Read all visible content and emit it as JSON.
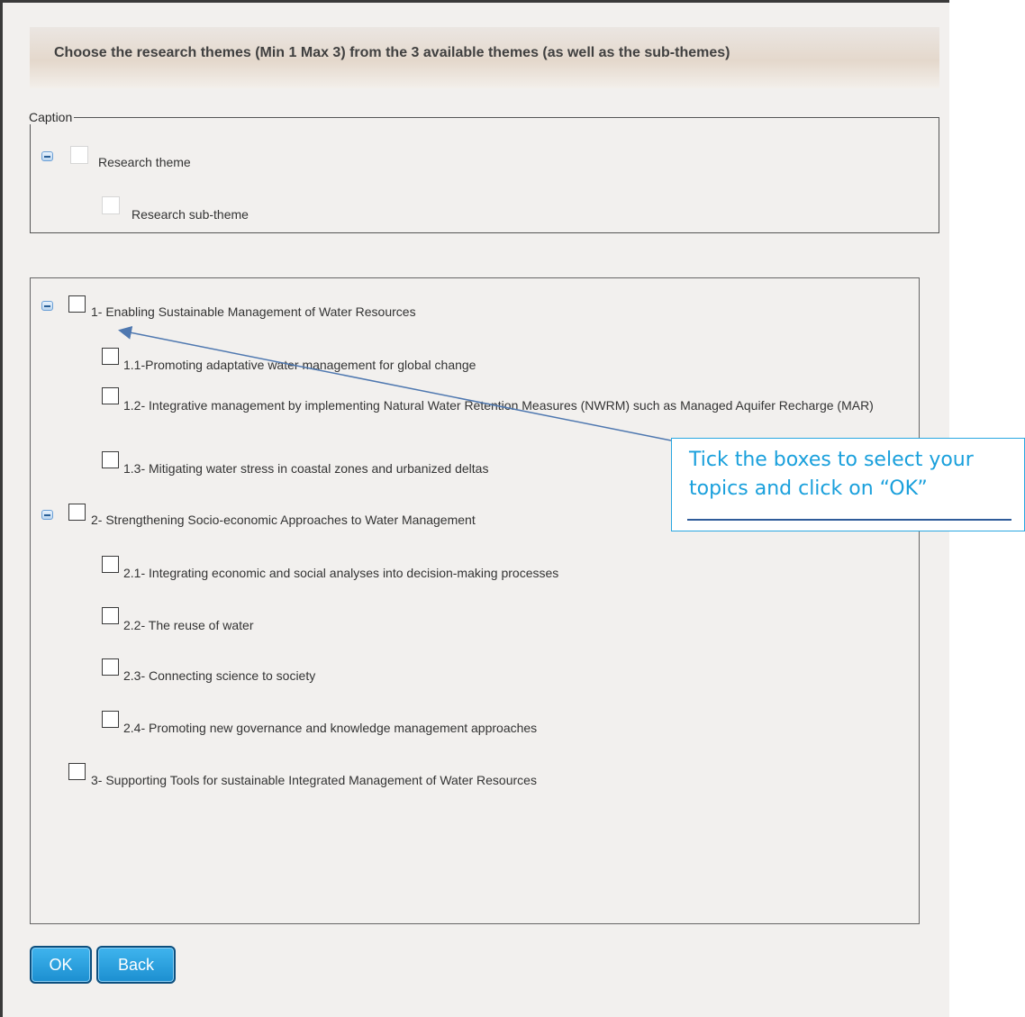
{
  "header": {
    "title": "Choose the research themes (Min 1 Max 3) from the 3 available themes (as well as the sub-themes)"
  },
  "caption": {
    "legend": "Caption",
    "theme_label": "Research theme",
    "subtheme_label": "Research sub-theme"
  },
  "themes": [
    {
      "label": "1- Enabling Sustainable Management of Water Resources",
      "subthemes": [
        "1.1-Promoting adaptative water management for global change",
        "1.2- Integrative management by implementing Natural Water Retention Measures (NWRM) such as Managed Aquifer Recharge (MAR)",
        "1.3- Mitigating water stress in coastal zones and urbanized deltas"
      ]
    },
    {
      "label": "2- Strengthening Socio-economic Approaches to Water Management",
      "subthemes": [
        "2.1- Integrating economic and social analyses into decision-making processes",
        "2.2- The reuse of water",
        "2.3- Connecting science to society",
        "2.4- Promoting new governance and knowledge management approaches"
      ]
    },
    {
      "label": "3- Supporting Tools for sustainable Integrated Management of Water Resources",
      "subthemes": []
    }
  ],
  "buttons": {
    "ok": "OK",
    "back": "Back"
  },
  "callout": {
    "text": "Tick the boxes to select your topics and click on “OK”",
    "color": "#1aa0dc"
  },
  "colors": {
    "button": "#1c8fd0",
    "header_band": "#e4d8cc",
    "panel_bg": "#f2f0ee"
  }
}
